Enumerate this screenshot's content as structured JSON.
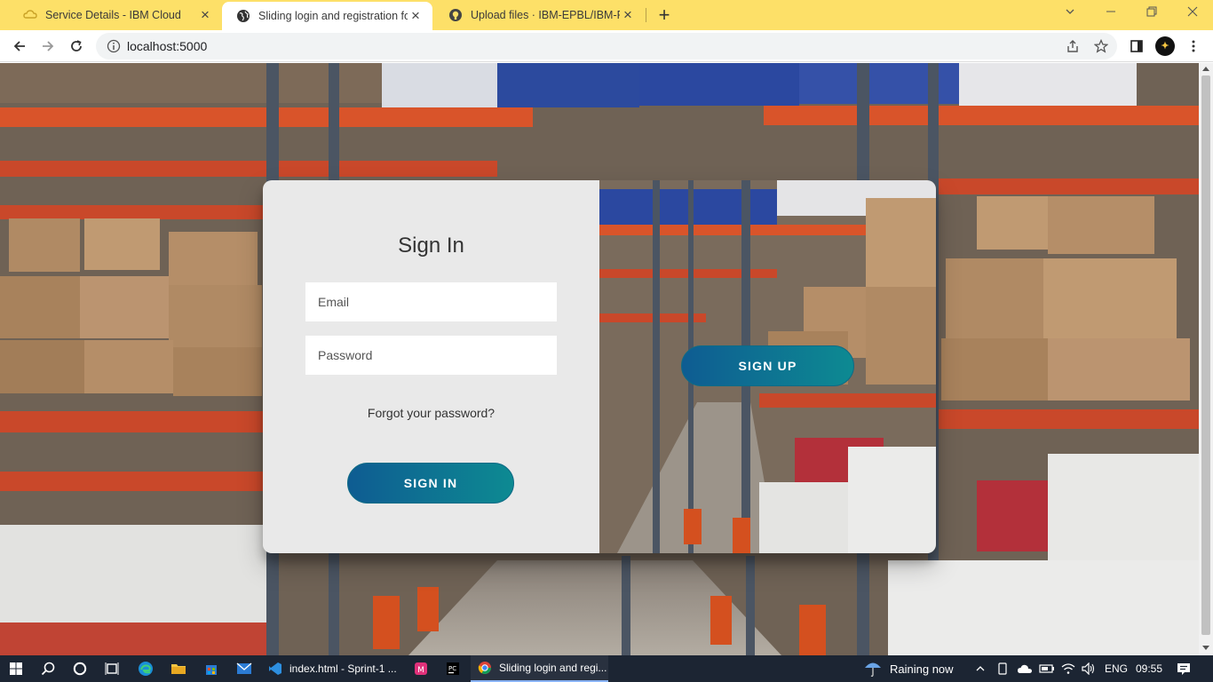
{
  "browser": {
    "tabs": [
      {
        "title": "Service Details - IBM Cloud",
        "active": false
      },
      {
        "title": "Sliding login and registration form",
        "active": true
      },
      {
        "title": "Upload files · IBM-EPBL/IBM-Project",
        "active": false
      }
    ],
    "new_tab_symbol": "+",
    "address": "localhost:5000"
  },
  "page": {
    "signin_title": "Sign In",
    "email_placeholder": "Email",
    "password_placeholder": "Password",
    "forgot_password": "Forgot your password?",
    "signin_button": "SIGN IN",
    "signup_button": "SIGN UP",
    "button_gradient": [
      "#0e5c92",
      "#0d8a92"
    ],
    "panel_color": "#e9e9e9"
  },
  "taskbar": {
    "apps": [
      {
        "label": "index.html - Sprint-1 ..."
      },
      {
        "label": "Sliding login and regi..."
      }
    ],
    "weather": "Raining now",
    "language": "ENG",
    "time": "09:55"
  },
  "colors": {
    "tabstrip": "#fde068",
    "taskbar": "#1c2533"
  }
}
